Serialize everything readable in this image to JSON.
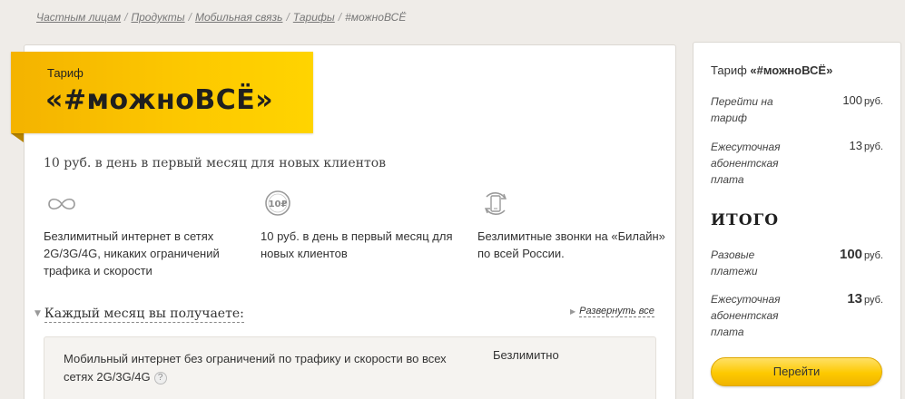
{
  "breadcrumb": {
    "items": [
      "Частным лицам",
      "Продукты",
      "Мобильная связь",
      "Тарифы"
    ],
    "separator": "/",
    "current": "#можноВСЁ"
  },
  "tariff": {
    "label": "Тариф",
    "name": "«#можноВСЁ»",
    "promo": "10 руб. в день в первый месяц для новых клиентов"
  },
  "features": [
    {
      "icon": "infinity-icon",
      "text": "Безлимитный интернет в сетях 2G/3G/4G, никаких ограничений трафика и скорости"
    },
    {
      "icon": "ten-rubles-coin-icon",
      "icon_text": "10₽",
      "text": "10 руб. в день в первый месяц для новых клиентов"
    },
    {
      "icon": "phone-call-icon",
      "text": "Безлимитные звонки на «Билайн» по всей России."
    }
  ],
  "monthly": {
    "title": "Каждый месяц вы получаете:",
    "expand_label": "Развернуть все",
    "items": [
      {
        "description": "Мобильный интернет без ограничений по трафику и скорости во всех сетях 2G/3G/4G",
        "help": "?",
        "value": "Безлимитно"
      }
    ]
  },
  "summary": {
    "title_prefix": "Тариф",
    "title_name": "«#можноВСЁ»",
    "rows": [
      {
        "label": "Перейти на тариф",
        "value": "100",
        "currency": "руб."
      },
      {
        "label": "Ежесуточная абонентская плата",
        "value": "13",
        "currency": "руб."
      }
    ],
    "total_label": "ИТОГО",
    "total_rows": [
      {
        "label": "Разовые платежи",
        "value": "100",
        "currency": "руб."
      },
      {
        "label": "Ежесуточная абонентская плата",
        "value": "13",
        "currency": "руб."
      }
    ],
    "button_label": "Перейти"
  },
  "colors": {
    "accent_yellow": "#fdc900",
    "background": "#efece8"
  }
}
